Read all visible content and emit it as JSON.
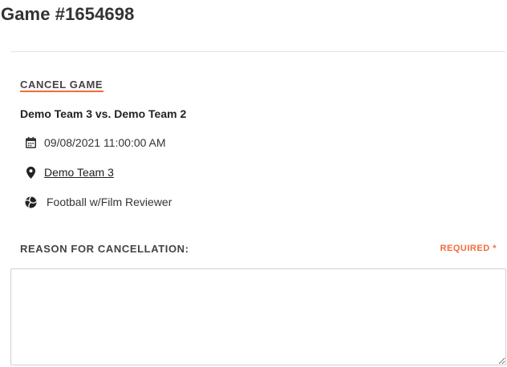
{
  "header": {
    "title": "Game #1654698"
  },
  "cancel_section": {
    "title": "CANCEL GAME",
    "matchup": "Demo Team 3 vs. Demo Team 2",
    "datetime": "09/08/2021 11:00:00 AM",
    "location": "Demo Team 3",
    "game_type": "Football w/Film Reviewer"
  },
  "reason": {
    "label": "REASON FOR CANCELLATION:",
    "required": "REQUIRED *",
    "value": "",
    "placeholder": ""
  },
  "icons": {
    "date": "calendar-icon",
    "location": "map-pin-icon",
    "type": "ball-icon"
  },
  "colors": {
    "accent": "#f26b3a"
  }
}
